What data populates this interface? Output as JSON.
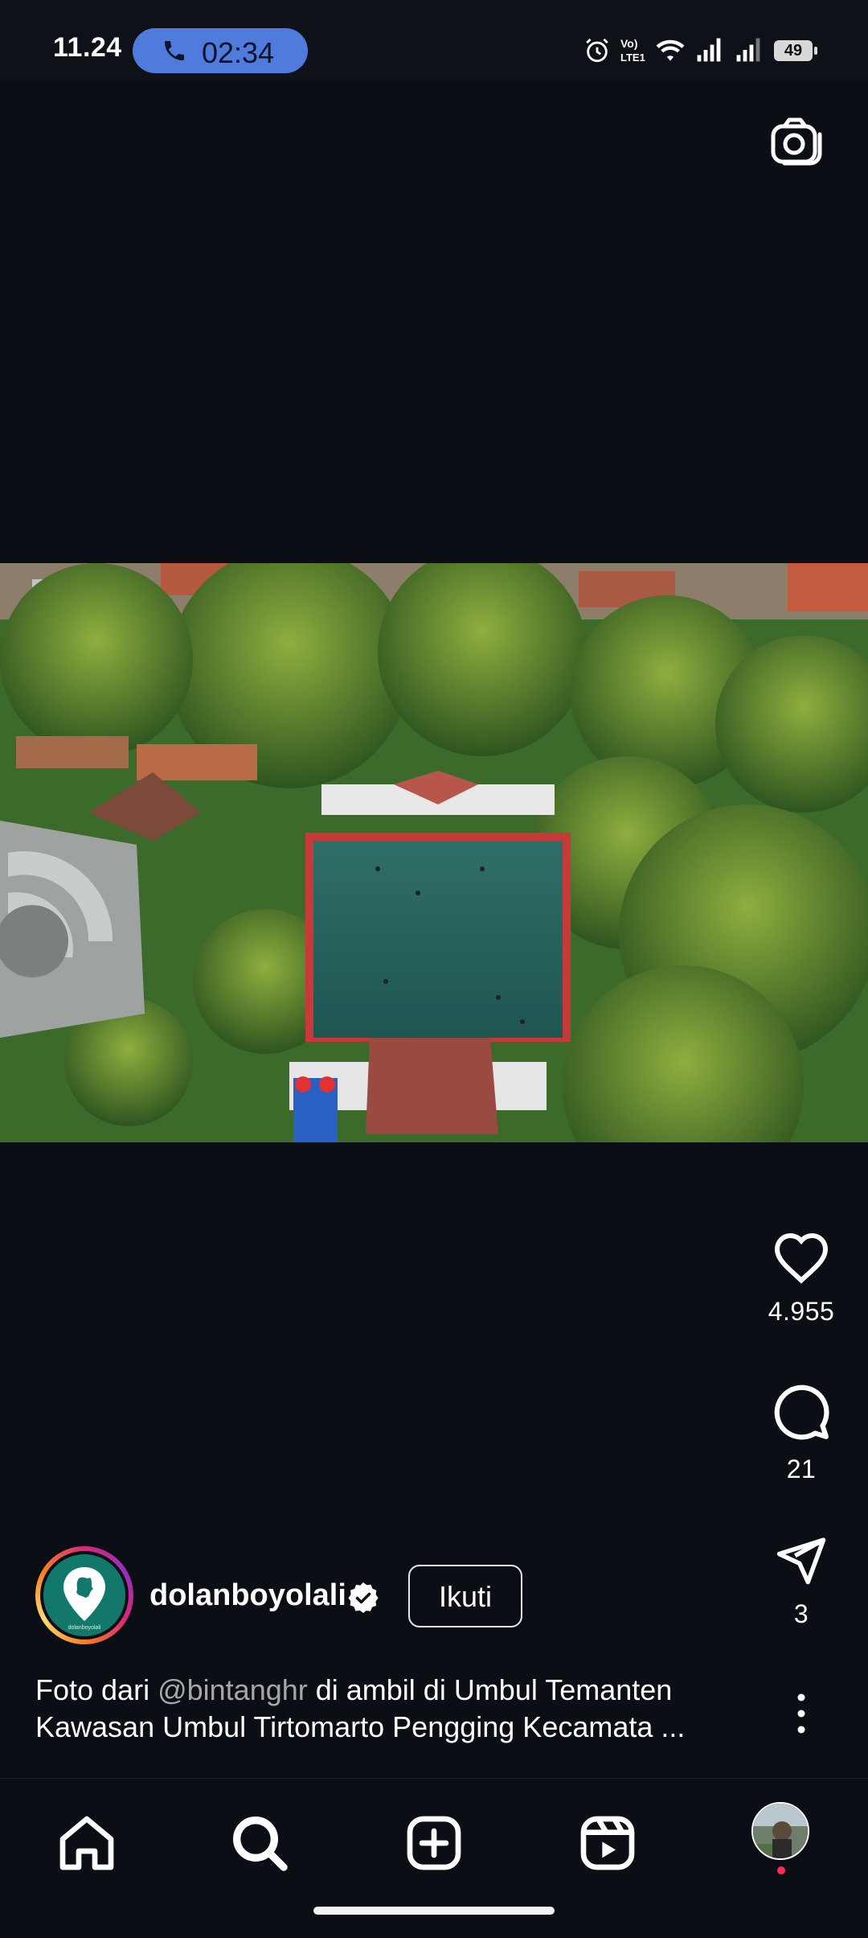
{
  "status_bar": {
    "time": "11.24",
    "call_timer": "02:34",
    "battery_level": "49",
    "icons": [
      "alarm-icon",
      "volte-icon",
      "wifi-icon",
      "signal-icon",
      "signal-icon",
      "battery-icon"
    ]
  },
  "post": {
    "username": "dolanboyolali",
    "verified": true,
    "follow_label": "Ikuti",
    "caption_prefix": "Foto dari ",
    "caption_mention": "@bintanghr",
    "caption_rest": " di ambil di Umbul Temanten Kawasan Umbul Tirtomarto Pengging Kecamata ...",
    "avatar_caption": "dolanboyolali",
    "likes": "4.955",
    "comments": "21",
    "shares": "3"
  },
  "nav": {
    "items": [
      "home-icon",
      "search-icon",
      "create-icon",
      "reels-icon",
      "profile-avatar"
    ]
  },
  "colors": {
    "background": "#0b0e14",
    "call_pill": "#4f7bdc",
    "avatar_logo": "#12786b",
    "notification_dot": "#ff2d55"
  }
}
